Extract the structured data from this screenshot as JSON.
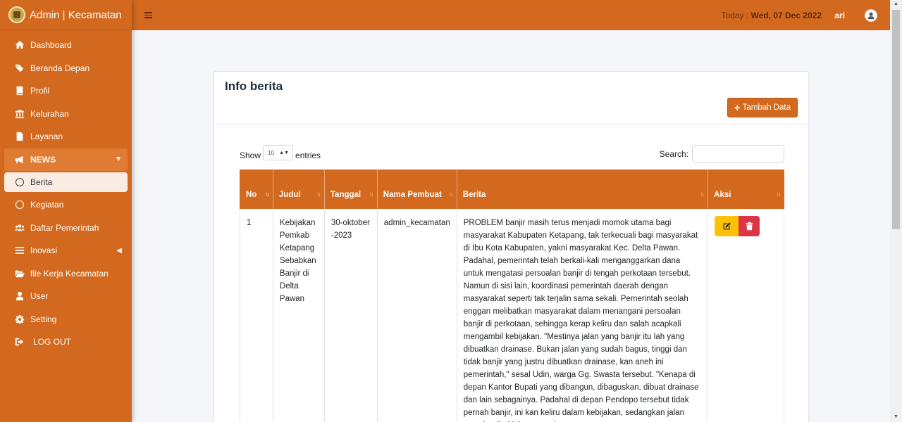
{
  "brand": {
    "title": "Admin | Kecamatan"
  },
  "sidebar": {
    "items": [
      {
        "label": "Dashboard",
        "icon": "home-icon"
      },
      {
        "label": "Beranda Depan",
        "icon": "tags-icon"
      },
      {
        "label": "Profil",
        "icon": "book-icon"
      },
      {
        "label": "Kelurahan",
        "icon": "university-icon"
      },
      {
        "label": "Layanan",
        "icon": "file-icon"
      },
      {
        "label": "NEWS",
        "icon": "bullhorn-icon"
      },
      {
        "label": "Berita",
        "icon": "circle-icon"
      },
      {
        "label": "Kegiatan",
        "icon": "circle-icon"
      },
      {
        "label": "Daftar Pemerintah",
        "icon": "users-icon"
      },
      {
        "label": "Inovasi",
        "icon": "bars-icon"
      },
      {
        "label": "file Kerja Kecamatan",
        "icon": "folder-open-icon"
      },
      {
        "label": "User",
        "icon": "user-icon"
      },
      {
        "label": "Setting",
        "icon": "gear-icon"
      },
      {
        "label": "LOG OUT",
        "icon": "sign-out-icon"
      }
    ]
  },
  "topbar": {
    "today_label": "Today : ",
    "today_date": "Wed, 07 Dec 2022",
    "username": "ari"
  },
  "card": {
    "title": "Info berita",
    "add_button": "Tambah Data"
  },
  "table_controls": {
    "show_label": "Show",
    "entries_value": "10",
    "entries_label": "entries",
    "search_label": "Search:"
  },
  "table": {
    "columns": [
      "No",
      "Judul",
      "Tanggal",
      "Nama Pembuat",
      "Berita",
      "Aksi"
    ],
    "rows": [
      {
        "no": "1",
        "judul": "Kebijakan Pemkab Ketapang Sebabkan Banjir di Delta Pawan",
        "tanggal": "30-oktober-2023",
        "pembuat": "admin_kecamatan",
        "berita": "PROBLEM banjir masih terus menjadi momok utama bagi masyarakat Kabupaten Ketapang, tak terkecuali bagi masyarakat di Ibu Kota Kabupaten, yakni masyarakat Kec. Delta Pawan. Padahal, pemerintah telah berkali-kali menganggarkan dana untuk mengatasi persoalan banjir di tengah perkotaan tersebut. Namun di sisi lain, koordinasi pemerintah daerah dengan masyarakat seperti tak terjalin sama sekali. Pemerintah seolah enggan melibatkan masyarakat dalam menangani persoalan banjir di perkotaan, sehingga kerap keliru dan salah acapkali mengambil kebijakan. \"Mestinya jalan yang banjir itu lah yang dibuatkan drainase. Bukan jalan yang sudah bagus, tinggi dan tidak banjir yang justru dibuatkan drainase, kan aneh ini pemerintah,\" sesal Udin, warga Gg. Swasta tersebut. \"Kenapa di depan Kantor Bupati yang dibangun, dibaguskan, dibuat drainase dan lain sebagainya. Padahal di depan Pendopo tersebut tidak pernah banjir, ini kan keliru dalam kebijakan, sedangkan jalan yang banjir tidak tersentuh"
      }
    ]
  },
  "colors": {
    "primary": "#d2691e",
    "warning": "#ffc107",
    "danger": "#dc3545"
  }
}
